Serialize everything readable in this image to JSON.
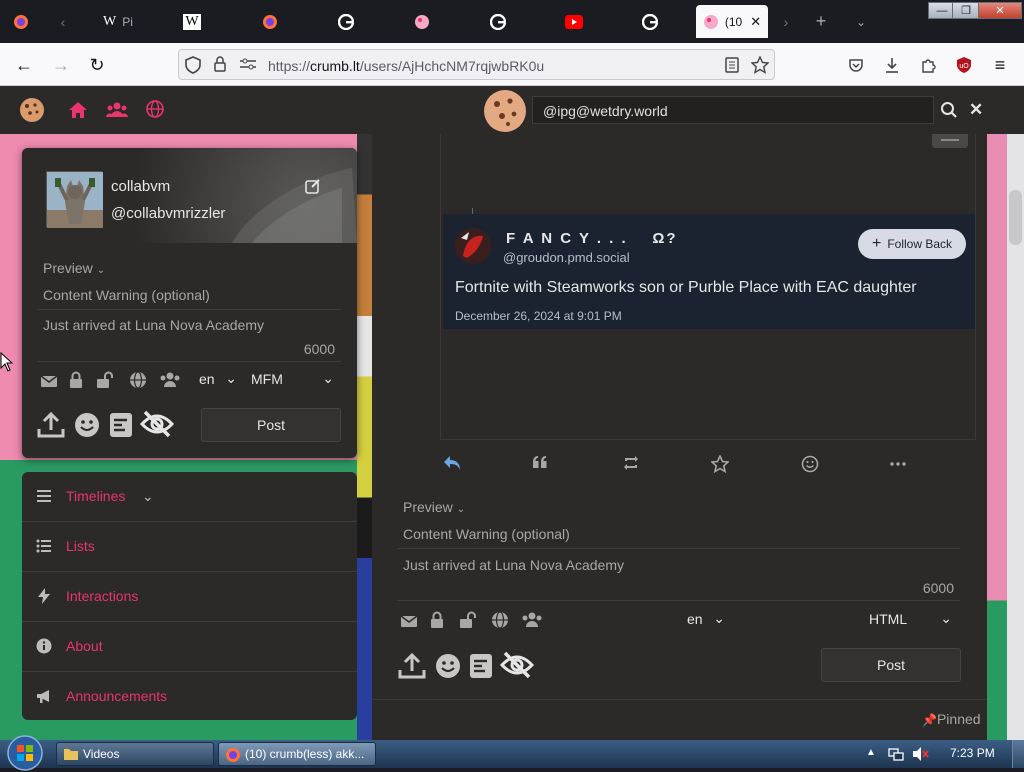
{
  "browser": {
    "tabs": [
      {
        "label": "",
        "icon": "firefox-icon"
      },
      {
        "label": "",
        "icon": "back-arrow-icon"
      },
      {
        "label": "Pi",
        "icon": "wikipedia-icon"
      },
      {
        "label": "",
        "icon": "wikipedia-icon"
      },
      {
        "label": "",
        "icon": "firefox-icon"
      },
      {
        "label": "",
        "icon": "google-icon"
      },
      {
        "label": "",
        "icon": "crumb-icon"
      },
      {
        "label": "",
        "icon": "google-icon"
      },
      {
        "label": "",
        "icon": "youtube-icon"
      },
      {
        "label": "",
        "icon": "google-icon"
      },
      {
        "label": "(10",
        "icon": "crumb-icon",
        "active": true
      }
    ],
    "url_prefix": "https://",
    "url_domain": "crumb.lt",
    "url_path": "/users/AjHchcNM7rqjwbRK0u"
  },
  "header": {
    "search_value": "@ipg@wetdry.world"
  },
  "compose_left": {
    "display_name": "collabvm",
    "handle": "@collabvmrizzler",
    "preview_label": "Preview",
    "cw_placeholder": "Content Warning (optional)",
    "body_text": "Just arrived at Luna Nova Academy",
    "char_count": "6000",
    "language": "en",
    "format": "MFM",
    "post_label": "Post"
  },
  "nav": {
    "items": [
      {
        "label": "Timelines",
        "icon": "menu-lines-icon"
      },
      {
        "label": "Lists",
        "icon": "list-icon"
      },
      {
        "label": "Interactions",
        "icon": "bolt-icon"
      },
      {
        "label": "About",
        "icon": "info-icon"
      },
      {
        "label": "Announcements",
        "icon": "megaphone-icon"
      }
    ]
  },
  "repost": {
    "display_name": "F A N C Y . . .    Ω?",
    "handle": "@groudon.pmd.social",
    "follow_label": "Follow Back",
    "text": "Fortnite with Steamworks son or Purble Place with EAC daughter",
    "date": "December 26, 2024 at 9:01 PM"
  },
  "compose_right": {
    "preview_label": "Preview",
    "cw_placeholder": "Content Warning (optional)",
    "body_text": "Just arrived at Luna Nova Academy",
    "char_count": "6000",
    "language": "en",
    "format": "HTML",
    "post_label": "Post",
    "pinned_label": "Pinned"
  },
  "taskbar": {
    "tasks": [
      {
        "label": "Videos"
      },
      {
        "label": "(10) crumb(less) akk..."
      }
    ],
    "clock": "7:23 PM"
  },
  "colors": {
    "accent": "#e8356b",
    "panel": "#2b2a28"
  }
}
